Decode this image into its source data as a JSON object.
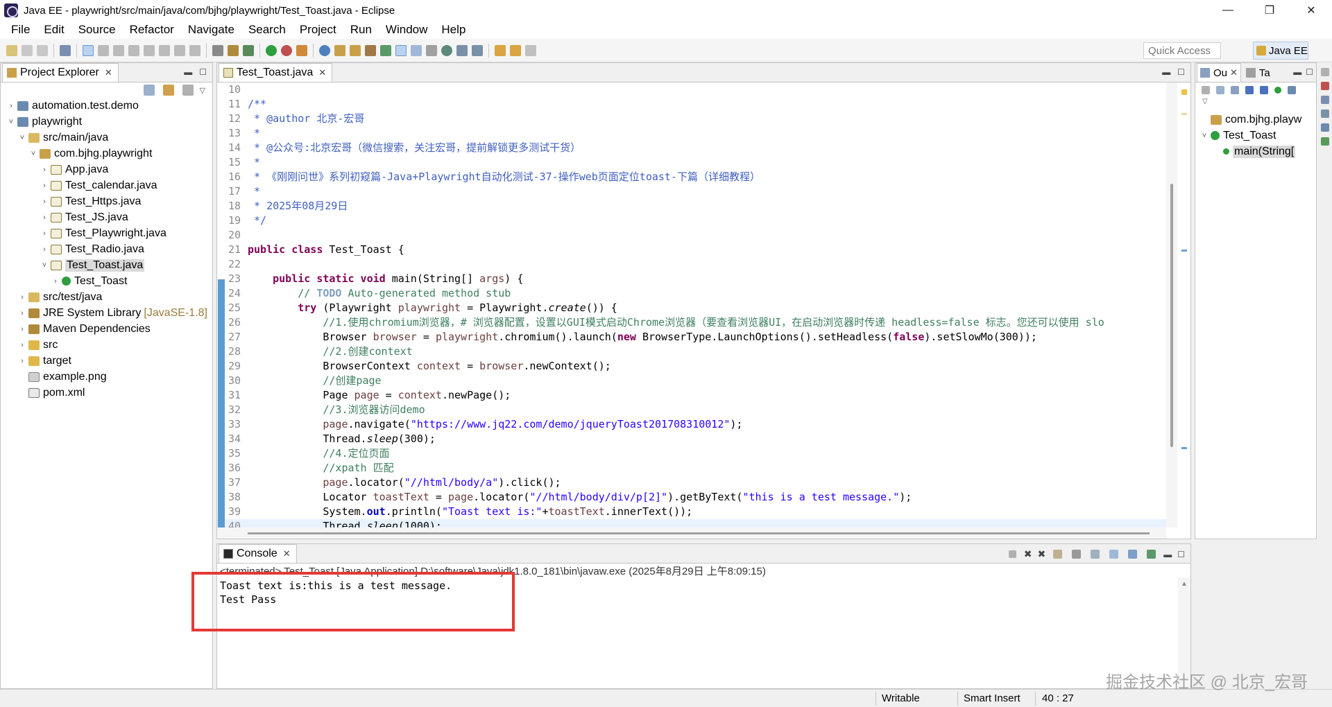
{
  "window": {
    "title": "Java EE - playwright/src/main/java/com/bjhg/playwright/Test_Toast.java - Eclipse"
  },
  "menu": [
    "File",
    "Edit",
    "Source",
    "Refactor",
    "Navigate",
    "Search",
    "Project",
    "Run",
    "Window",
    "Help"
  ],
  "toolbar": {
    "quick_access_placeholder": "Quick Access",
    "perspective_label": "Java EE"
  },
  "project_explorer": {
    "tab_label": "Project Explorer",
    "tree": [
      {
        "label": "automation.test.demo",
        "indent": 0,
        "twisty": "›",
        "icon": "project",
        "selected": false
      },
      {
        "label": "playwright",
        "indent": 0,
        "twisty": "˅",
        "icon": "project",
        "selected": false
      },
      {
        "label": "src/main/java",
        "indent": 1,
        "twisty": "˅",
        "icon": "source-folder",
        "selected": false
      },
      {
        "label": "com.bjhg.playwright",
        "indent": 2,
        "twisty": "˅",
        "icon": "package",
        "selected": false
      },
      {
        "label": "App.java",
        "indent": 3,
        "twisty": "›",
        "icon": "java-file",
        "selected": false
      },
      {
        "label": "Test_calendar.java",
        "indent": 3,
        "twisty": "›",
        "icon": "java-file",
        "selected": false
      },
      {
        "label": "Test_Https.java",
        "indent": 3,
        "twisty": "›",
        "icon": "java-file",
        "selected": false
      },
      {
        "label": "Test_JS.java",
        "indent": 3,
        "twisty": "›",
        "icon": "java-file",
        "selected": false
      },
      {
        "label": "Test_Playwright.java",
        "indent": 3,
        "twisty": "›",
        "icon": "java-file",
        "selected": false
      },
      {
        "label": "Test_Radio.java",
        "indent": 3,
        "twisty": "›",
        "icon": "java-file",
        "selected": false
      },
      {
        "label": "Test_Toast.java",
        "indent": 3,
        "twisty": "˅",
        "icon": "java-file",
        "selected": true
      },
      {
        "label": "Test_Toast",
        "indent": 4,
        "twisty": "›",
        "icon": "class",
        "selected": false
      },
      {
        "label": "src/test/java",
        "indent": 1,
        "twisty": "›",
        "icon": "source-folder",
        "selected": false
      },
      {
        "label": "JRE System Library",
        "tag": "[JavaSE-1.8]",
        "indent": 1,
        "twisty": "›",
        "icon": "library",
        "selected": false
      },
      {
        "label": "Maven Dependencies",
        "indent": 1,
        "twisty": "›",
        "icon": "library",
        "selected": false
      },
      {
        "label": "src",
        "indent": 1,
        "twisty": "›",
        "icon": "folder",
        "selected": false
      },
      {
        "label": "target",
        "indent": 1,
        "twisty": "›",
        "icon": "folder",
        "selected": false
      },
      {
        "label": "example.png",
        "indent": 1,
        "twisty": "",
        "icon": "image-file",
        "selected": false
      },
      {
        "label": "pom.xml",
        "indent": 1,
        "twisty": "",
        "icon": "xml-file",
        "selected": false
      }
    ]
  },
  "editor": {
    "tab_label": "Test_Toast.java",
    "lines": [
      {
        "n": "10",
        "t": []
      },
      {
        "n": "11",
        "fold": true,
        "t": [
          [
            "c-doc",
            "/**"
          ]
        ]
      },
      {
        "n": "12",
        "t": [
          [
            "c-doc",
            " * @author 北京-宏哥"
          ]
        ]
      },
      {
        "n": "13",
        "t": [
          [
            "c-doc",
            " *"
          ]
        ]
      },
      {
        "n": "14",
        "t": [
          [
            "c-doc",
            " * @公众号:北京宏哥（微信搜索，关注宏哥，提前解锁更多测试干货）"
          ]
        ]
      },
      {
        "n": "15",
        "t": [
          [
            "c-doc",
            " *"
          ]
        ]
      },
      {
        "n": "16",
        "t": [
          [
            "c-doc",
            " * 《刚刚问世》系列初窥篇-Java+Playwright自动化测试-37-操作web页面定位toast-下篇（详细教程）"
          ]
        ]
      },
      {
        "n": "17",
        "t": [
          [
            "c-doc",
            " *"
          ]
        ]
      },
      {
        "n": "18",
        "t": [
          [
            "c-doc",
            " * 2025年08月29日"
          ]
        ]
      },
      {
        "n": "19",
        "t": [
          [
            "c-doc",
            " */"
          ]
        ]
      },
      {
        "n": "20",
        "t": []
      },
      {
        "n": "21",
        "t": [
          [
            "c-kw",
            "public class"
          ],
          [
            "",
            " Test_Toast {"
          ]
        ]
      },
      {
        "n": "22",
        "t": []
      },
      {
        "n": "23",
        "fold": true,
        "t": [
          [
            "",
            "    "
          ],
          [
            "c-kw",
            "public static void"
          ],
          [
            "",
            " main(String[] "
          ],
          [
            "c-var",
            "args"
          ],
          [
            "",
            ") {"
          ]
        ]
      },
      {
        "n": "24",
        "t": [
          [
            "",
            "        "
          ],
          [
            "c-comment",
            "// "
          ],
          [
            "c-todo",
            "TODO"
          ],
          [
            "c-comment",
            " Auto-generated method stub"
          ]
        ]
      },
      {
        "n": "25",
        "t": [
          [
            "",
            "        "
          ],
          [
            "c-kw",
            "try"
          ],
          [
            "",
            " (Playwright "
          ],
          [
            "c-var",
            "playwright"
          ],
          [
            "",
            " = Playwright."
          ],
          [
            "c-ital",
            "create"
          ],
          [
            "",
            "()) {"
          ]
        ]
      },
      {
        "n": "26",
        "t": [
          [
            "",
            "            "
          ],
          [
            "c-comment",
            "//1.使用chromium浏览器，# 浏览器配置，设置以GUI模式启动Chrome浏览器（要查看浏览器UI，在启动浏览器时传递 headless=false 标志。您还可以使用 slo"
          ]
        ]
      },
      {
        "n": "27",
        "t": [
          [
            "",
            "            Browser "
          ],
          [
            "c-var",
            "browser"
          ],
          [
            "",
            " = "
          ],
          [
            "c-var",
            "playwright"
          ],
          [
            "",
            ".chromium().launch("
          ],
          [
            "c-kw",
            "new"
          ],
          [
            "",
            " BrowserType.LaunchOptions().setHeadless("
          ],
          [
            "c-kw",
            "false"
          ],
          [
            "",
            ").setSlowMo(300));"
          ]
        ]
      },
      {
        "n": "28",
        "t": [
          [
            "",
            "            "
          ],
          [
            "c-comment",
            "//2.创建context"
          ]
        ]
      },
      {
        "n": "29",
        "t": [
          [
            "",
            "            BrowserContext "
          ],
          [
            "c-var",
            "context"
          ],
          [
            "",
            " = "
          ],
          [
            "c-var",
            "browser"
          ],
          [
            "",
            ".newContext();"
          ]
        ]
      },
      {
        "n": "30",
        "t": [
          [
            "",
            "            "
          ],
          [
            "c-comment",
            "//创建page"
          ]
        ]
      },
      {
        "n": "31",
        "t": [
          [
            "",
            "            Page "
          ],
          [
            "c-var",
            "page"
          ],
          [
            "",
            " = "
          ],
          [
            "c-var",
            "context"
          ],
          [
            "",
            ".newPage();"
          ]
        ]
      },
      {
        "n": "32",
        "t": [
          [
            "",
            "            "
          ],
          [
            "c-comment",
            "//3.浏览器访问demo"
          ]
        ]
      },
      {
        "n": "33",
        "t": [
          [
            "",
            "            "
          ],
          [
            "c-var",
            "page"
          ],
          [
            "",
            ".navigate("
          ],
          [
            "c-str",
            "\"https://www.jq22.com/demo/jqueryToast201708310012\""
          ],
          [
            "",
            ");"
          ]
        ]
      },
      {
        "n": "34",
        "t": [
          [
            "",
            "            Thread."
          ],
          [
            "c-ital",
            "sleep"
          ],
          [
            "",
            "(300);"
          ]
        ]
      },
      {
        "n": "35",
        "t": [
          [
            "",
            "            "
          ],
          [
            "c-comment",
            "//4.定位页面"
          ]
        ]
      },
      {
        "n": "36",
        "t": [
          [
            "",
            "            "
          ],
          [
            "c-comment",
            "//xpath 匹配"
          ]
        ]
      },
      {
        "n": "37",
        "t": [
          [
            "",
            "            "
          ],
          [
            "c-var",
            "page"
          ],
          [
            "",
            ".locator("
          ],
          [
            "c-str",
            "\"//html/body/a\""
          ],
          [
            "",
            ").click();"
          ]
        ]
      },
      {
        "n": "38",
        "t": [
          [
            "",
            "            Locator "
          ],
          [
            "c-var",
            "toastText"
          ],
          [
            "",
            " = "
          ],
          [
            "c-var",
            "page"
          ],
          [
            "",
            ".locator("
          ],
          [
            "c-str",
            "\"//html/body/div/p[2]\""
          ],
          [
            "",
            ").getByText("
          ],
          [
            "c-str",
            "\"this is a test message.\""
          ],
          [
            "",
            ");"
          ]
        ]
      },
      {
        "n": "39",
        "t": [
          [
            "",
            "            System."
          ],
          [
            "c-field",
            "out"
          ],
          [
            "",
            ".println("
          ],
          [
            "c-str",
            "\"Toast text is:\""
          ],
          [
            "",
            "+"
          ],
          [
            "c-var",
            "toastText"
          ],
          [
            "",
            ".innerText());"
          ]
        ]
      },
      {
        "n": "40",
        "current": true,
        "t": [
          [
            "",
            "            Thread."
          ],
          [
            "c-ital",
            "sleep"
          ],
          [
            "",
            "(1000);"
          ]
        ]
      }
    ]
  },
  "outline": {
    "tab1_label": "Ou",
    "tab2_label": "Ta",
    "items": [
      {
        "label": "com.bjhg.playw",
        "indent": 0,
        "twisty": "",
        "icon": "package"
      },
      {
        "label": "Test_Toast",
        "indent": 0,
        "twisty": "˅",
        "icon": "class"
      },
      {
        "label": "main(String[",
        "indent": 1,
        "twisty": "",
        "icon": "method",
        "selected": true
      }
    ]
  },
  "console": {
    "tab_label": "Console",
    "header": "<terminated> Test_Toast [Java Application] D:\\software\\Java\\jdk1.8.0_181\\bin\\javaw.exe (2025年8月29日 上午8:09:15)",
    "output": "Toast text is:this is a test message.\nTest Pass"
  },
  "statusbar": {
    "writable": "Writable",
    "insert_mode": "Smart Insert",
    "position": "40 : 27"
  },
  "watermark": "掘金技术社区 @ 北京_宏哥",
  "colors": {
    "highlight_box": "#e53935",
    "keyword": "#7f0055",
    "string": "#2a00ff",
    "comment": "#3f7f5f",
    "javadoc": "#3f5fbf"
  }
}
